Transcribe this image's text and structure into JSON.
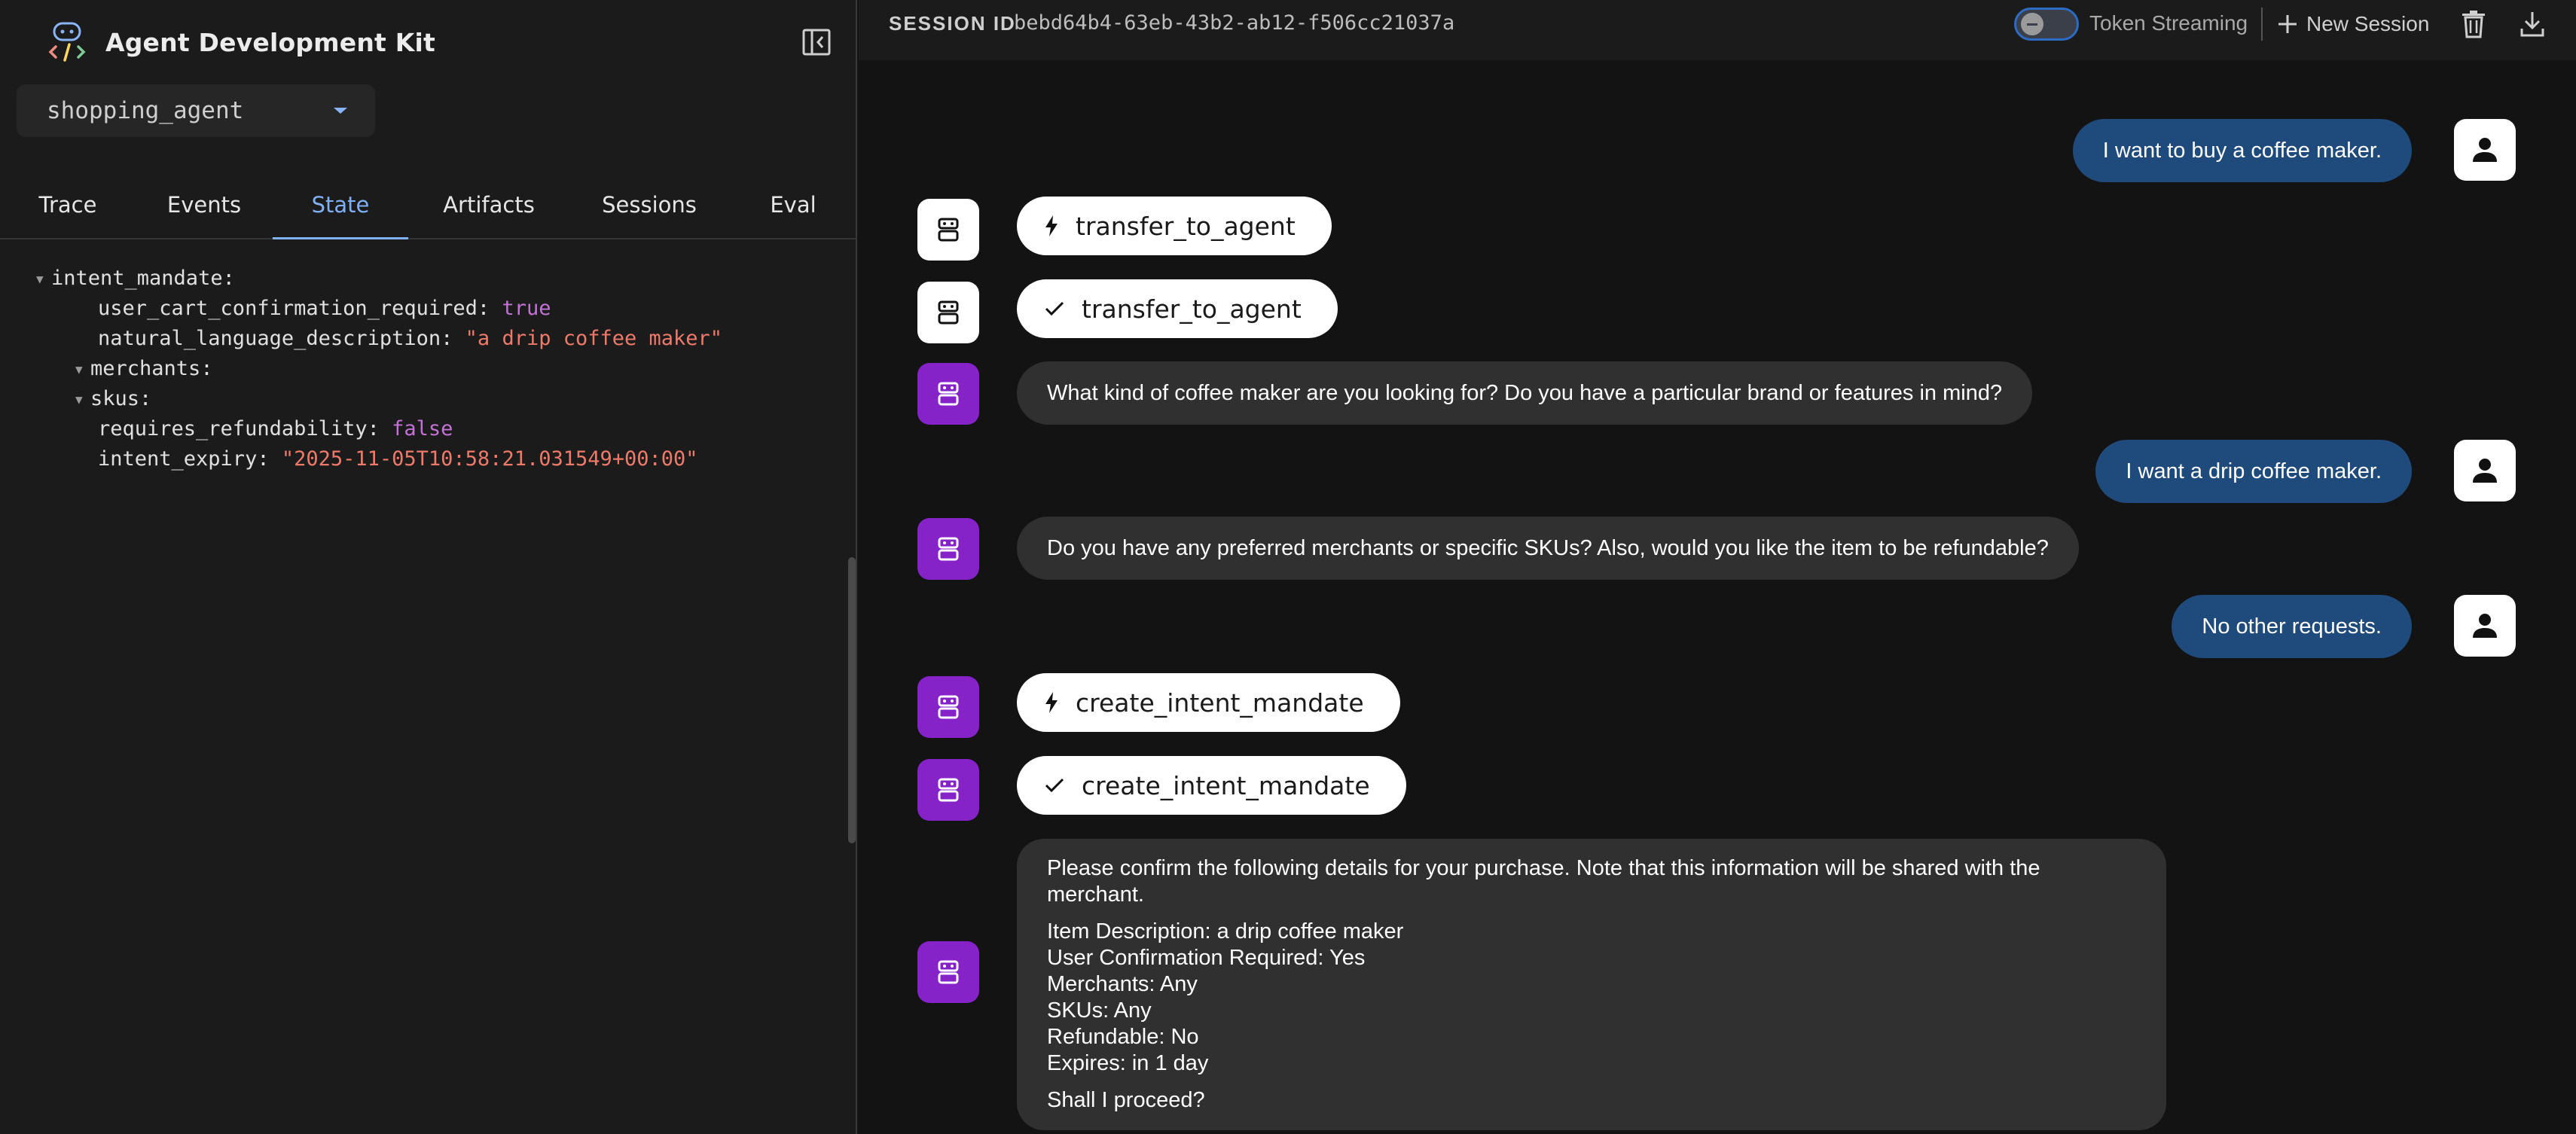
{
  "app": {
    "title": "Agent Development Kit"
  },
  "agent_select": {
    "value": "shopping_agent"
  },
  "tabs": [
    {
      "label": "Trace"
    },
    {
      "label": "Events"
    },
    {
      "label": "State",
      "active": true
    },
    {
      "label": "Artifacts"
    },
    {
      "label": "Sessions"
    },
    {
      "label": "Eval"
    }
  ],
  "state": {
    "root_key": "intent_mandate",
    "user_cart_confirmation_required": {
      "key": "user_cart_confirmation_required",
      "value": "true"
    },
    "natural_language_description": {
      "key": "natural_language_description",
      "value": "\"a drip coffee maker\""
    },
    "merchants": {
      "key": "merchants"
    },
    "skus": {
      "key": "skus"
    },
    "requires_refundability": {
      "key": "requires_refundability",
      "value": "false"
    },
    "intent_expiry": {
      "key": "intent_expiry",
      "value": "\"2025-11-05T10:58:21.031549+00:00\""
    }
  },
  "topbar": {
    "session_label": "SESSION ID",
    "session_id": "bebd64b4-63eb-43b2-ab12-f506cc21037a",
    "streaming_label": "Token Streaming",
    "new_session_label": "New Session"
  },
  "chat": {
    "m1": "I want to buy a coffee maker.",
    "f1": "transfer_to_agent",
    "f2": "transfer_to_agent",
    "m2": "What kind of coffee maker are you looking for? Do you have a particular brand or features in mind?",
    "m3": "I want a drip coffee maker.",
    "m4": "Do you have any preferred merchants or specific SKUs? Also, would you like the item to be refundable?",
    "m5": "No other requests.",
    "f3": "create_intent_mandate",
    "f4": "create_intent_mandate",
    "confirm": {
      "intro": "Please confirm the following details for your purchase. Note that this information will be shared with the merchant.",
      "lines": [
        "Item Description: a drip coffee maker",
        "User Confirmation Required: Yes",
        "Merchants: Any",
        "SKUs: Any",
        "Refundable: No",
        "Expires: in 1 day"
      ],
      "question": "Shall I proceed?"
    }
  },
  "colors": {
    "accent": "#7fb0f5",
    "user_bubble": "#1f4b7c",
    "bot_avatar": "#8522c8",
    "bool_value": "#c472d6",
    "string_value": "#f07a6a"
  }
}
